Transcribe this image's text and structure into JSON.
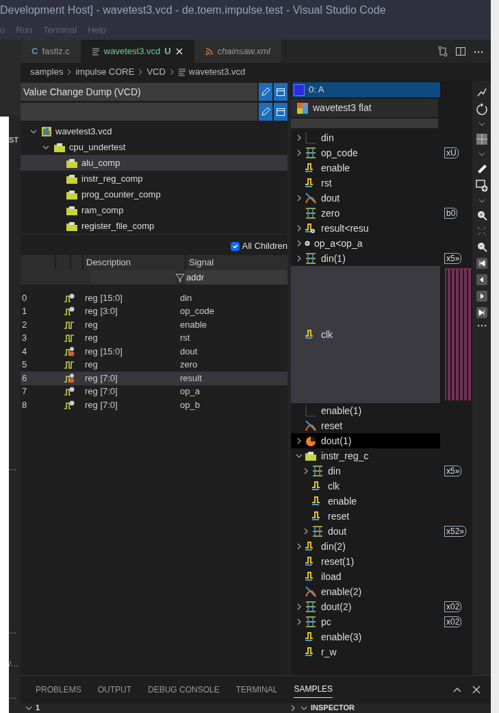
{
  "window": {
    "title": "Development Host] - wavetest3.vcd - de.toem.impulse.test - Visual Studio Code"
  },
  "menu": [
    "o",
    "Run",
    "Terminal",
    "Help"
  ],
  "side_strip": [
    "ST",
    "…",
    "…",
    "/…",
    "…"
  ],
  "tabs": [
    {
      "label": "fastlz.c",
      "kind": "c",
      "icon": "C",
      "selected": false,
      "italic": false
    },
    {
      "label": "wavetest3.vcd",
      "kind": "text",
      "badge": "U",
      "selected": true,
      "italic": false
    },
    {
      "label": "chainsaw.xml",
      "kind": "rss",
      "selected": false,
      "italic": true
    }
  ],
  "breadcrumbs": [
    "samples",
    "impulse CORE",
    "VCD",
    "wavetest3.vcd"
  ],
  "fields": [
    {
      "kind": "text",
      "value": "Value Change Dump (VCD)"
    },
    {
      "kind": "blank"
    }
  ],
  "tree": [
    {
      "label": "wavetest3.vcd",
      "kind": "record",
      "expanded": true,
      "selected": false,
      "children": [
        {
          "label": "cpu_undertest",
          "kind": "folder",
          "expanded": true,
          "selected": false,
          "children": [
            {
              "label": "alu_comp",
              "kind": "folder",
              "selected": true
            },
            {
              "label": "instr_reg_comp",
              "kind": "folder",
              "selected": false
            },
            {
              "label": "prog_counter_comp",
              "kind": "folder",
              "selected": false
            },
            {
              "label": "ram_comp",
              "kind": "folder",
              "selected": false
            },
            {
              "label": "register_file_comp",
              "kind": "folder",
              "selected": false
            }
          ]
        }
      ]
    }
  ],
  "all_children": {
    "label": "All Children",
    "checked": true
  },
  "table": {
    "columns": [
      "Description",
      "Signal"
    ],
    "signal_filter": "addr",
    "rows": [
      {
        "index": "0",
        "kind": "n",
        "description": "reg [15:0]",
        "signal": "din",
        "selected": false
      },
      {
        "index": "1",
        "kind": "n",
        "description": "reg [3:0]",
        "signal": "op_code",
        "selected": false
      },
      {
        "index": "2",
        "kind": "plain",
        "description": "reg",
        "signal": "enable",
        "selected": false
      },
      {
        "index": "3",
        "kind": "plain",
        "description": "reg",
        "signal": "rst",
        "selected": false
      },
      {
        "index": "4",
        "kind": "nc",
        "description": "reg [15:0]",
        "signal": "dout",
        "selected": false
      },
      {
        "index": "5",
        "kind": "plain",
        "description": "reg",
        "signal": "zero",
        "selected": false
      },
      {
        "index": "6",
        "kind": "nc",
        "description": "reg [7:0]",
        "signal": "result",
        "selected": true
      },
      {
        "index": "7",
        "kind": "n",
        "description": "reg [7:0]",
        "signal": "op_a",
        "selected": false
      },
      {
        "index": "8",
        "kind": "n",
        "description": "reg [7:0]",
        "signal": "op_b",
        "selected": false
      }
    ]
  },
  "signals": {
    "header": {
      "label": "0: A",
      "selected": true
    },
    "source": {
      "label": "wavetest3 flat"
    },
    "items": [
      {
        "label": "din",
        "kind": "line",
        "expandable": true,
        "selected": false,
        "highlighted": false
      },
      {
        "label": "op_code",
        "kind": "bus",
        "expandable": true,
        "selected": false,
        "highlighted": false,
        "value": "xU"
      },
      {
        "label": "enable",
        "kind": "digital",
        "expandable": false,
        "selected": false,
        "highlighted": false
      },
      {
        "label": "rst",
        "kind": "digital",
        "expandable": false,
        "selected": false,
        "highlighted": false
      },
      {
        "label": "dout",
        "kind": "cross",
        "expandable": true,
        "selected": false,
        "highlighted": false
      },
      {
        "label": "zero",
        "kind": "bus",
        "expandable": false,
        "selected": false,
        "highlighted": false,
        "value": "b0"
      },
      {
        "label": "result<resu",
        "kind": "digital-config",
        "expandable": true,
        "selected": false,
        "highlighted": false
      },
      {
        "label": "op_a<op_a",
        "kind": "config",
        "expandable": true,
        "selected": false,
        "highlighted": false
      },
      {
        "label": "din(1)",
        "kind": "bus",
        "expandable": true,
        "selected": false,
        "highlighted": false,
        "value": "x5»"
      },
      {
        "label": "clk",
        "kind": "digital",
        "expandable": false,
        "selected": false,
        "highlighted": true
      },
      {
        "label": "enable(1)",
        "kind": "line",
        "expandable": false,
        "selected": false,
        "highlighted": false
      },
      {
        "label": "reset",
        "kind": "cross",
        "expandable": false,
        "selected": false,
        "highlighted": false
      },
      {
        "label": "dout(1)",
        "kind": "pie",
        "expandable": true,
        "selected": true,
        "highlighted": false
      },
      {
        "label": "instr_reg_c",
        "kind": "folder",
        "expandable": true,
        "expanded": true,
        "selected": false,
        "highlighted": false,
        "children": [
          {
            "label": "din",
            "kind": "bus",
            "expandable": true,
            "selected": false,
            "highlighted": false,
            "value": "x5»"
          },
          {
            "label": "clk",
            "kind": "digital",
            "expandable": false,
            "selected": false,
            "highlighted": false
          },
          {
            "label": "enable",
            "kind": "digital",
            "expandable": false,
            "selected": false,
            "highlighted": false
          },
          {
            "label": "reset",
            "kind": "digital",
            "expandable": false,
            "selected": false,
            "highlighted": false
          },
          {
            "label": "dout",
            "kind": "bus",
            "expandable": true,
            "selected": false,
            "highlighted": false,
            "value": "x52»"
          }
        ]
      },
      {
        "label": "din(2)",
        "kind": "digital",
        "expandable": true,
        "selected": false,
        "highlighted": false
      },
      {
        "label": "reset(1)",
        "kind": "digital",
        "expandable": false,
        "selected": false,
        "highlighted": false
      },
      {
        "label": "iload",
        "kind": "digital",
        "expandable": false,
        "selected": false,
        "highlighted": false
      },
      {
        "label": "enable(2)",
        "kind": "cross",
        "expandable": false,
        "selected": false,
        "highlighted": false
      },
      {
        "label": "dout(2)",
        "kind": "bus",
        "expandable": true,
        "selected": false,
        "highlighted": false,
        "value": "x02"
      },
      {
        "label": "pc",
        "kind": "bus",
        "expandable": true,
        "selected": false,
        "highlighted": false,
        "value": "x02"
      },
      {
        "label": "enable(3)",
        "kind": "digital",
        "expandable": false,
        "selected": false,
        "highlighted": false
      },
      {
        "label": "r_w",
        "kind": "digital",
        "expandable": false,
        "selected": false,
        "highlighted": false
      }
    ]
  },
  "panel": {
    "tabs": [
      {
        "label": "PROBLEMS",
        "selected": false
      },
      {
        "label": "OUTPUT",
        "selected": false
      },
      {
        "label": "DEBUG CONSOLE",
        "selected": false
      },
      {
        "label": "TERMINAL",
        "selected": false
      },
      {
        "label": "SAMPLES",
        "selected": true
      }
    ],
    "section": {
      "label": "1",
      "expanded": true
    },
    "inspector": {
      "label": "INSPECTOR",
      "expanded": true
    }
  }
}
